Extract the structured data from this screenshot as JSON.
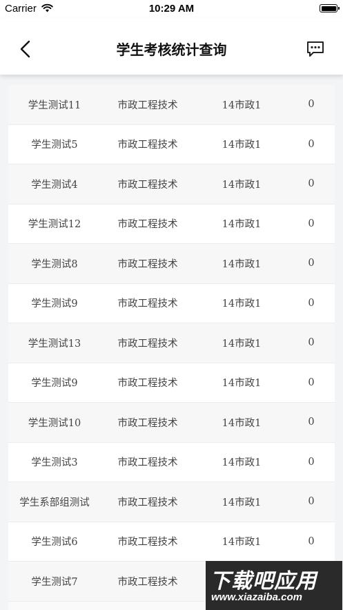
{
  "status_bar": {
    "carrier": "Carrier",
    "time": "10:29 AM"
  },
  "nav": {
    "title": "学生考核统计查询"
  },
  "rows": [
    {
      "name": "学生测试11",
      "major": "市政工程技术",
      "class": "14市政1",
      "count": "0"
    },
    {
      "name": "学生测试5",
      "major": "市政工程技术",
      "class": "14市政1",
      "count": "0"
    },
    {
      "name": "学生测试4",
      "major": "市政工程技术",
      "class": "14市政1",
      "count": "0"
    },
    {
      "name": "学生测试12",
      "major": "市政工程技术",
      "class": "14市政1",
      "count": "0"
    },
    {
      "name": "学生测试8",
      "major": "市政工程技术",
      "class": "14市政1",
      "count": "0"
    },
    {
      "name": "学生测试9",
      "major": "市政工程技术",
      "class": "14市政1",
      "count": "0"
    },
    {
      "name": "学生测试13",
      "major": "市政工程技术",
      "class": "14市政1",
      "count": "0"
    },
    {
      "name": "学生测试9",
      "major": "市政工程技术",
      "class": "14市政1",
      "count": "0"
    },
    {
      "name": "学生测试10",
      "major": "市政工程技术",
      "class": "14市政1",
      "count": "0"
    },
    {
      "name": "学生测试3",
      "major": "市政工程技术",
      "class": "14市政1",
      "count": "0"
    },
    {
      "name": "学生系部组测试",
      "major": "市政工程技术",
      "class": "14市政1",
      "count": "0"
    },
    {
      "name": "学生测试6",
      "major": "市政工程技术",
      "class": "14市政1",
      "count": "0"
    },
    {
      "name": "学生测试7",
      "major": "市政工程技术",
      "class": "",
      "count": ""
    }
  ],
  "watermark": {
    "line1": "下载吧应用",
    "line2": "www.xiazaiba.com"
  }
}
